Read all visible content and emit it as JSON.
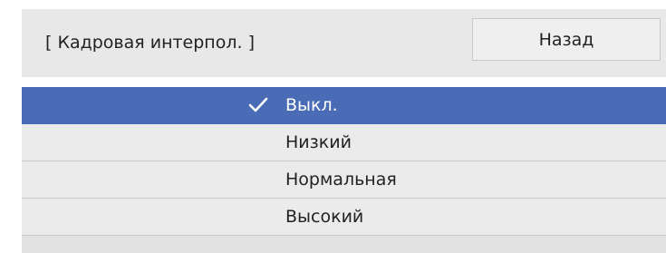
{
  "header": {
    "title": "[ Кадровая интерпол. ]",
    "back_label": "Назад"
  },
  "options": [
    {
      "label": "Выкл.",
      "selected": true
    },
    {
      "label": "Низкий",
      "selected": false
    },
    {
      "label": "Нормальная",
      "selected": false
    },
    {
      "label": "Высокий",
      "selected": false
    }
  ],
  "colors": {
    "selected_background": "#4a6bb5",
    "panel_background": "#e8e8e8"
  },
  "icons": {
    "selected_marker": "checkmark-icon"
  }
}
